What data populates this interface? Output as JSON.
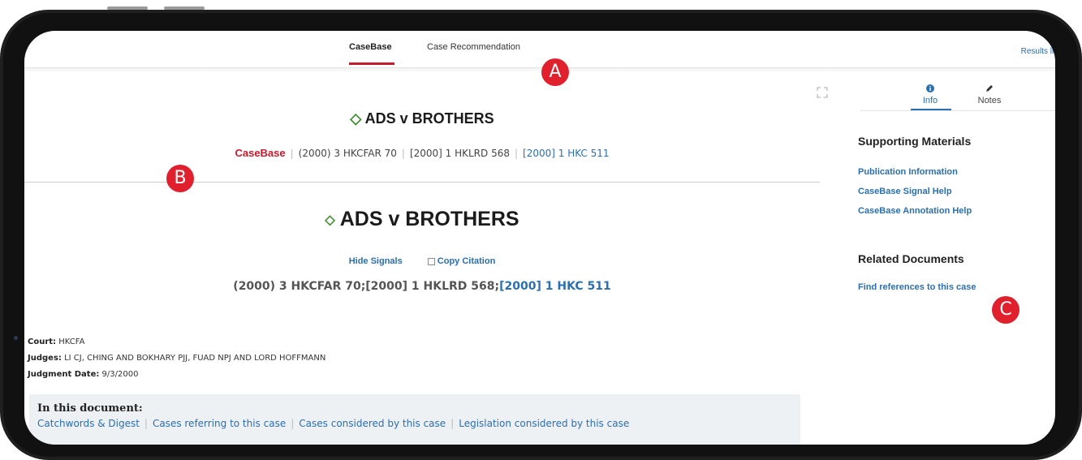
{
  "tabs": [
    {
      "label": "CaseBase",
      "active": true
    },
    {
      "label": "Case Recommendation",
      "active": false
    }
  ],
  "results_link": "Results list",
  "document": {
    "title_small": "ADS v BROTHERS",
    "citations": {
      "brand": "CaseBase",
      "items": [
        "(2000) 3 HKCFAR 70",
        "[2000] 1 HKLRD 568"
      ],
      "link": "[2000] 1 HKC 511"
    },
    "title_big": "ADS v BROTHERS",
    "hide_signals": "Hide Signals",
    "copy_citation": "Copy Citation",
    "full_citation": {
      "text": "(2000) 3 HKCFAR 70;[2000] 1 HKLRD 568;",
      "link": "[2000] 1 HKC 511"
    },
    "meta": {
      "court_label": "Court:",
      "court": "HKCFA",
      "judges_label": "Judges:",
      "judges": "LI CJ, CHING AND BOKHARY PJJ, FUAD NPJ AND LORD HOFFMANN",
      "date_label": "Judgment Date:",
      "date": "9/3/2000"
    },
    "in_this_document": {
      "title": "In this document:",
      "links": [
        "Catchwords & Digest",
        "Cases referring to this case",
        "Cases considered by this case",
        "Legislation considered by this case"
      ]
    }
  },
  "right_panel": {
    "tabs": [
      {
        "label": "Info",
        "icon": "info-icon",
        "active": true
      },
      {
        "label": "Notes",
        "icon": "pencil-icon",
        "active": false
      }
    ],
    "supporting_heading": "Supporting Materials",
    "supporting_links": [
      "Publication Information",
      "CaseBase Signal Help",
      "CaseBase Annotation Help"
    ],
    "related_heading": "Related Documents",
    "related_links": [
      "Find references to this case"
    ]
  },
  "callouts": [
    "A",
    "B",
    "C"
  ],
  "colors": {
    "accent_red": "#c8192d",
    "link_blue": "#2a6fb0",
    "callout_red": "#e0202c",
    "diamond_green": "#3c8a2a"
  }
}
